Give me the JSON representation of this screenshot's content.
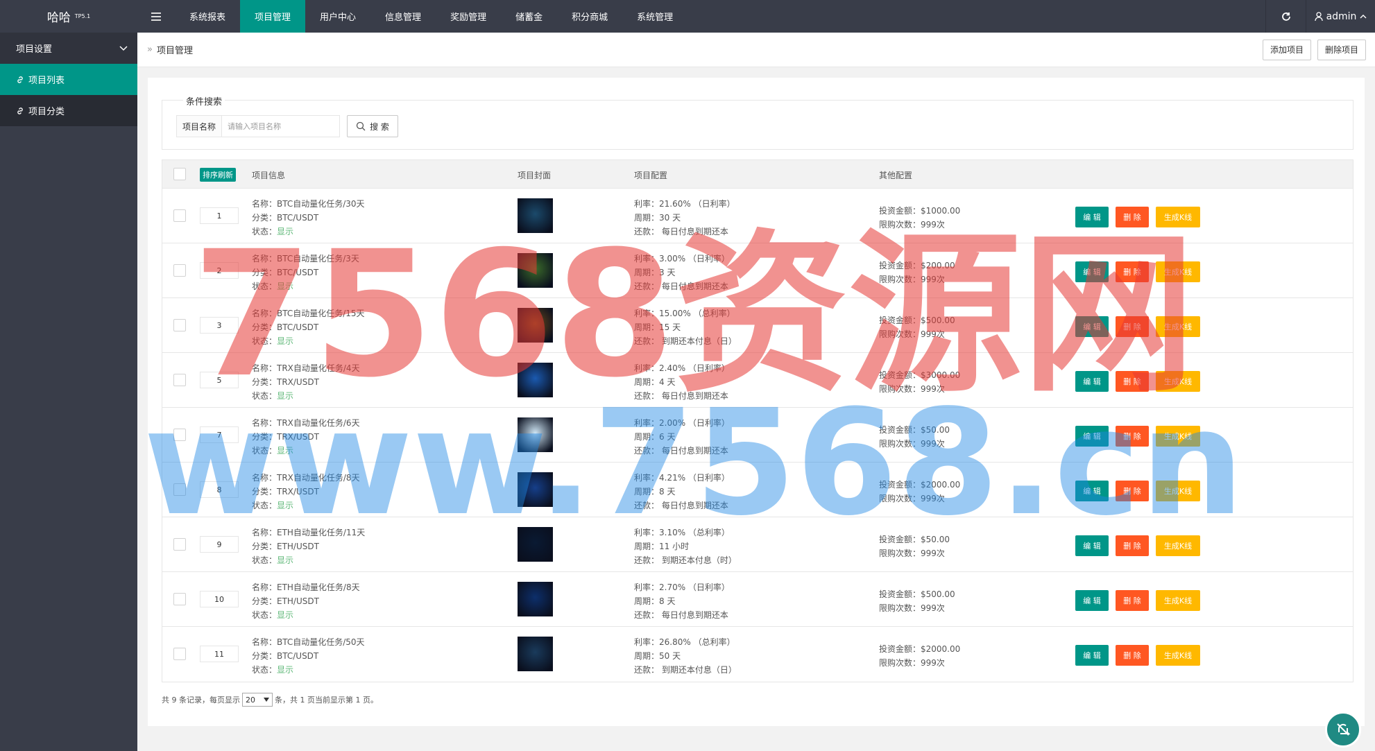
{
  "header": {
    "logo": "哈哈",
    "logo_sup": "TP5.1",
    "menu_icon": "menu-icon",
    "nav": [
      {
        "label": "系统报表"
      },
      {
        "label": "项目管理"
      },
      {
        "label": "用户中心"
      },
      {
        "label": "信息管理"
      },
      {
        "label": "奖励管理"
      },
      {
        "label": "储蓄金"
      },
      {
        "label": "积分商城"
      },
      {
        "label": "系统管理"
      }
    ],
    "active_nav": "项目管理",
    "user": "admin"
  },
  "sidebar": {
    "group": "项目设置",
    "items": [
      {
        "label": "项目列表"
      },
      {
        "label": "项目分类"
      }
    ]
  },
  "breadcrumb": {
    "current": "项目管理",
    "add_label": "添加项目",
    "delete_label": "删除项目"
  },
  "search": {
    "legend": "条件搜索",
    "label": "项目名称",
    "placeholder": "请输入项目名称",
    "button": "搜 索"
  },
  "table": {
    "sort_badge": "排序刷新",
    "headers": [
      "项目信息",
      "项目封面",
      "项目配置",
      "其他配置"
    ],
    "rows": [
      {
        "sort": "1",
        "name": "名称：BTC自动量化任务/30天",
        "cat": "分类：BTC/USDT",
        "status_label": "状态：",
        "status": "显示",
        "rate": "利率：21.60% （日利率）",
        "period": "周期：30 天",
        "repay": "还款：  每日付息到期还本",
        "amount": "投资金额：$1000.00",
        "limit": "限购次数：999次",
        "cover": "#1b4a6b"
      },
      {
        "sort": "2",
        "name": "名称：BTC自动量化任务/3天",
        "cat": "分类：BTC/USDT",
        "status_label": "状态：",
        "status": "显示",
        "rate": "利率：3.00% （日利率）",
        "period": "周期：3 天",
        "repay": "还款：  每日付息到期还本",
        "amount": "投资金额：$200.00",
        "limit": "限购次数：999次",
        "cover": "#3b6b2a"
      },
      {
        "sort": "3",
        "name": "名称：BTC自动量化任务/15天",
        "cat": "分类：BTC/USDT",
        "status_label": "状态：",
        "status": "显示",
        "rate": "利率：15.00% （总利率）",
        "period": "周期：15 天",
        "repay": "还款：  到期还本付息（日）",
        "amount": "投资金额：$500.00",
        "limit": "限购次数：999次",
        "cover": "#6b4a1b"
      },
      {
        "sort": "5",
        "name": "名称：TRX自动量化任务/4天",
        "cat": "分类：TRX/USDT",
        "status_label": "状态：",
        "status": "显示",
        "rate": "利率：2.40% （日利率）",
        "period": "周期：4 天",
        "repay": "还款：  每日付息到期还本",
        "amount": "投资金额：$3000.00",
        "limit": "限购次数：999次",
        "cover": "#1b5ab0"
      },
      {
        "sort": "7",
        "name": "名称：TRX自动量化任务/6天",
        "cat": "分类：TRX/USDT",
        "status_label": "状态：",
        "status": "显示",
        "rate": "利率：2.00% （日利率）",
        "period": "周期：6 天",
        "repay": "还款：  每日付息到期还本",
        "amount": "投资金额：$50.00",
        "limit": "限购次数：999次",
        "cover": "#cfe6f5"
      },
      {
        "sort": "8",
        "name": "名称：TRX自动量化任务/8天",
        "cat": "分类：TRX/USDT",
        "status_label": "状态：",
        "status": "显示",
        "rate": "利率：4.21% （日利率）",
        "period": "周期：8 天",
        "repay": "还款：  每日付息到期还本",
        "amount": "投资金额：$2000.00",
        "limit": "限购次数：999次",
        "cover": "#163f8a"
      },
      {
        "sort": "9",
        "name": "名称：ETH自动量化任务/11天",
        "cat": "分类：ETH/USDT",
        "status_label": "状态：",
        "status": "显示",
        "rate": "利率：3.10% （总利率）",
        "period": "周期：11 小时",
        "repay": "还款：  到期还本付息（时）",
        "amount": "投资金额：$50.00",
        "limit": "限购次数：999次",
        "cover": "#0a1a33"
      },
      {
        "sort": "10",
        "name": "名称：ETH自动量化任务/8天",
        "cat": "分类：ETH/USDT",
        "status_label": "状态：",
        "status": "显示",
        "rate": "利率：2.70% （日利率）",
        "period": "周期：8 天",
        "repay": "还款：  每日付息到期还本",
        "amount": "投资金额：$500.00",
        "limit": "限购次数：999次",
        "cover": "#0d2f6b"
      },
      {
        "sort": "11",
        "name": "名称：BTC自动量化任务/50天",
        "cat": "分类：BTC/USDT",
        "status_label": "状态：",
        "status": "显示",
        "rate": "利率：26.80% （总利率）",
        "period": "周期：50 天",
        "repay": "还款：  到期还本付息（日）",
        "amount": "投资金额：$2000.00",
        "limit": "限购次数：999次",
        "cover": "#1a3b5c"
      }
    ],
    "edit_label": "编 辑",
    "delete_label": "删 除",
    "kline_label": "生成K线"
  },
  "pager": {
    "prefix": "共 9 条记录，每页显示",
    "per_page": "20",
    "suffix": "条，共 1 页当前显示第 1 页。"
  },
  "watermark": {
    "line1": "7568资源网",
    "line2": "www.7568.cn"
  },
  "colors": {
    "primary": "#009688",
    "danger": "#ff5722",
    "warning": "#ffb800",
    "dark": "#393d49"
  }
}
